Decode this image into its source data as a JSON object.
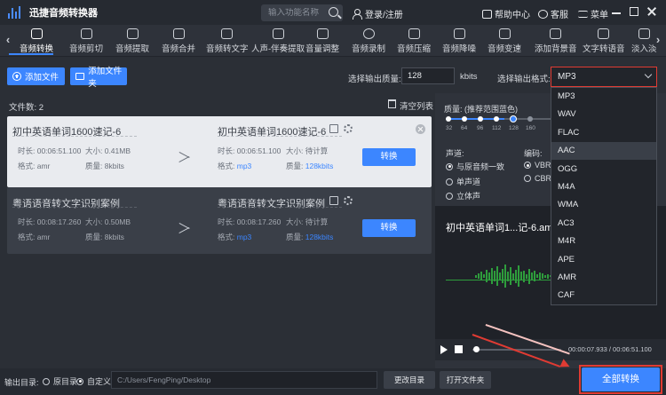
{
  "app": {
    "title": "迅捷音频转换器"
  },
  "titlebar": {
    "search_placeholder": "输入功能名称",
    "login": "登录/注册",
    "help": "帮助中心",
    "service": "客服",
    "menu": "菜单"
  },
  "tabs": [
    "音频转换",
    "音频剪切",
    "音频提取",
    "音频合并",
    "音频转文字",
    "人声-伴奏提取",
    "音量调整",
    "音频录制",
    "音频压缩",
    "音频降噪",
    "音频变速",
    "添加背景音",
    "文字转语音",
    "淡入淡"
  ],
  "actions": {
    "add_file": "添加文件",
    "add_folder": "添加文件夹",
    "quality_label": "选择输出质量:",
    "quality_value": "128",
    "quality_unit": "kbits",
    "format_label": "选择输出格式:",
    "format_value": "MP3"
  },
  "list": {
    "file_count": "文件数: 2",
    "clear_list": "清空列表",
    "items": [
      {
        "src_name": "初中英语单词1600速记-6",
        "src_duration": "时长: 00:06:51.100",
        "src_size": "大小: 0.41MB",
        "src_format": "格式: amr",
        "src_quality": "质量: 8kbits",
        "dst_name": "初中英语单词1600速记-6",
        "dst_duration": "时长: 00:06:51.100",
        "dst_size": "大小: 待计算",
        "dst_format_label": "格式:",
        "dst_format": "mp3",
        "dst_quality_label": "质量:",
        "dst_quality": "128kbits",
        "convert": "转换"
      },
      {
        "src_name": "粤语语音转文字识别案例",
        "src_duration": "时长: 00:08:17.260",
        "src_size": "大小: 0.50MB",
        "src_format": "格式: amr",
        "src_quality": "质量: 8kbits",
        "dst_name": "粤语语音转文字识别案例",
        "dst_duration": "时长: 00:08:17.260",
        "dst_size": "大小: 待计算",
        "dst_format_label": "格式:",
        "dst_format": "mp3",
        "dst_quality_label": "质量:",
        "dst_quality": "128kbits",
        "convert": "转换"
      }
    ]
  },
  "settings": {
    "quality_title": "质量: (推荐范围蓝色)",
    "quality_ticks": [
      "32",
      "64",
      "96",
      "112",
      "128",
      "160"
    ],
    "quality_selected": "128",
    "channel_title": "声道:",
    "channels": [
      "与原音频一致",
      "单声道",
      "立体声"
    ],
    "channel_selected": 0,
    "encoding_title": "编码:",
    "encodings": [
      "VBR",
      "CBR"
    ],
    "encoding_selected": 0
  },
  "preview": {
    "name": "初中英语单词1...记-6.amr",
    "time": "00:00:07.933 / 00:06:51.100",
    "progress": 0.02
  },
  "dropdown": {
    "options": [
      "MP3",
      "WAV",
      "FLAC",
      "AAC",
      "OGG",
      "M4A",
      "WMA",
      "AC3",
      "M4R",
      "APE",
      "AMR",
      "CAF"
    ],
    "hovered": "AAC"
  },
  "bottom": {
    "output_label": "输出目录:",
    "option_original": "原目录",
    "option_custom": "自定义",
    "path": "C:/Users/FengPing/Desktop",
    "change_dir": "更改目录",
    "open_folder": "打开文件夹",
    "convert_all": "全部转换"
  },
  "colors": {
    "accent": "#3c86ff",
    "highlight": "#e03b33",
    "wave": "#2e9d3c"
  }
}
